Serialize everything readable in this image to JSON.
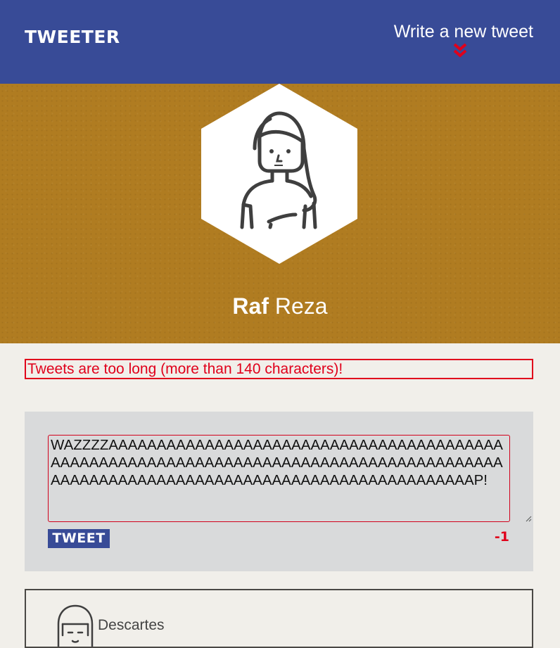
{
  "nav": {
    "brand": "TWEETER",
    "write_word": "Write",
    "compose_rest": "a new tweet",
    "chevron_icon": "double-chevron-down-icon",
    "chevron_color": "#e0001b"
  },
  "profile": {
    "avatar_icon": "woman-avatar-icon",
    "first_name": "Raf",
    "last_name": "Reza"
  },
  "error_message": "Tweets are too long (more than 140 characters)!",
  "composer": {
    "text": "WAZZZZAAAAAAAAAAAAAAAAAAAAAAAAAAAAAAAAAAAAAAAAAAAAAAAAAAAAAAAAAAAAAAAAAAAAAAAAAAAAAAAAAAAAAAAAAAAAAAAAAAAAAAAAAAAAAAAAAAAAAAAAAAAAAAAAAAAAP!",
    "button_label": "TWEET",
    "counter": "-1"
  },
  "tweets": [
    {
      "author": "Descartes",
      "avatar_icon": "girl-avatar-icon"
    }
  ],
  "colors": {
    "nav": "#384b97",
    "hero": "#b07c21",
    "error": "#e0001b",
    "composer_bg": "#d9dadb"
  }
}
